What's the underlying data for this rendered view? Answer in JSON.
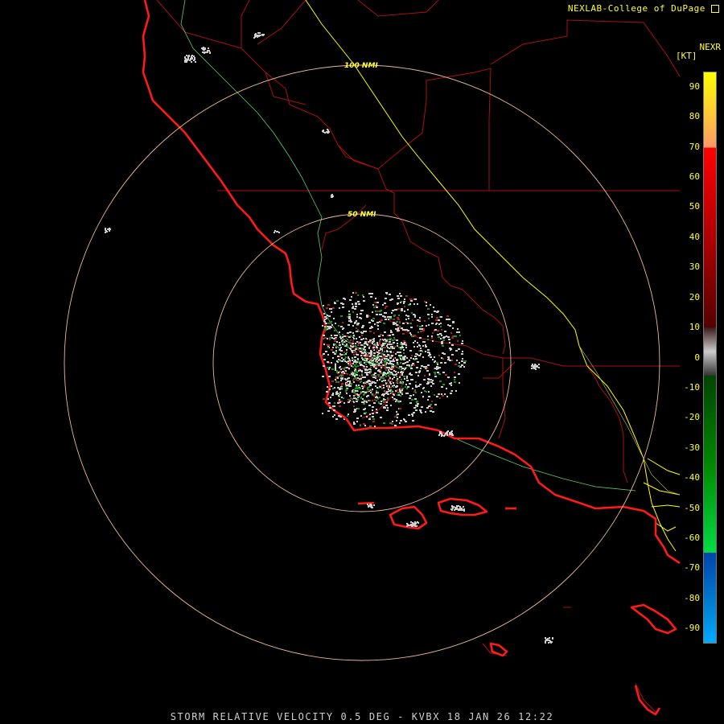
{
  "header": {
    "credit": "NEXLAB-College of DuPage",
    "product": "NEXR",
    "units": "[KT]"
  },
  "footer": {
    "caption": "STORM RELATIVE VELOCITY 0.5 DEG - KVBX 18 JAN 26 12:22"
  },
  "range_rings": [
    {
      "label": "50 NMI"
    },
    {
      "label": "100 NMI"
    }
  ],
  "legend": {
    "ticks": [
      "90",
      "80",
      "70",
      "60",
      "50",
      "40",
      "30",
      "20",
      "10",
      "0",
      "-10",
      "-20",
      "-30",
      "-40",
      "-50",
      "-60",
      "-70",
      "-80",
      "-90"
    ],
    "tick_values": [
      90,
      80,
      70,
      60,
      50,
      40,
      30,
      20,
      10,
      0,
      -10,
      -20,
      -30,
      -40,
      -50,
      -60,
      -70,
      -80,
      -90
    ],
    "range": [
      -95,
      95
    ],
    "bands": [
      {
        "from": 95,
        "to": 70,
        "colors": [
          "#ffff00",
          "#ffcc33",
          "#ff9966"
        ]
      },
      {
        "from": 70,
        "to": 10,
        "colors": [
          "#ff0000",
          "#b00000",
          "#550000"
        ]
      },
      {
        "from": 10,
        "to": -6,
        "colors": [
          "#3a1a1a",
          "#cccccc",
          "#333333"
        ]
      },
      {
        "from": -6,
        "to": -65,
        "colors": [
          "#004400",
          "#008800",
          "#00dd44"
        ]
      },
      {
        "from": -65,
        "to": -95,
        "colors": [
          "#0044aa",
          "#0077cc",
          "#00aaff"
        ]
      }
    ]
  },
  "colors": {
    "coastline": "#ff1a1a",
    "state_county": "#aa1111",
    "highway": "#ffff00",
    "river": "#66cc66",
    "ring": "#e9b79a",
    "echo_light": "#cfcfcf",
    "echo_inbound": "#119911",
    "echo_outbound": "#aa2222"
  }
}
